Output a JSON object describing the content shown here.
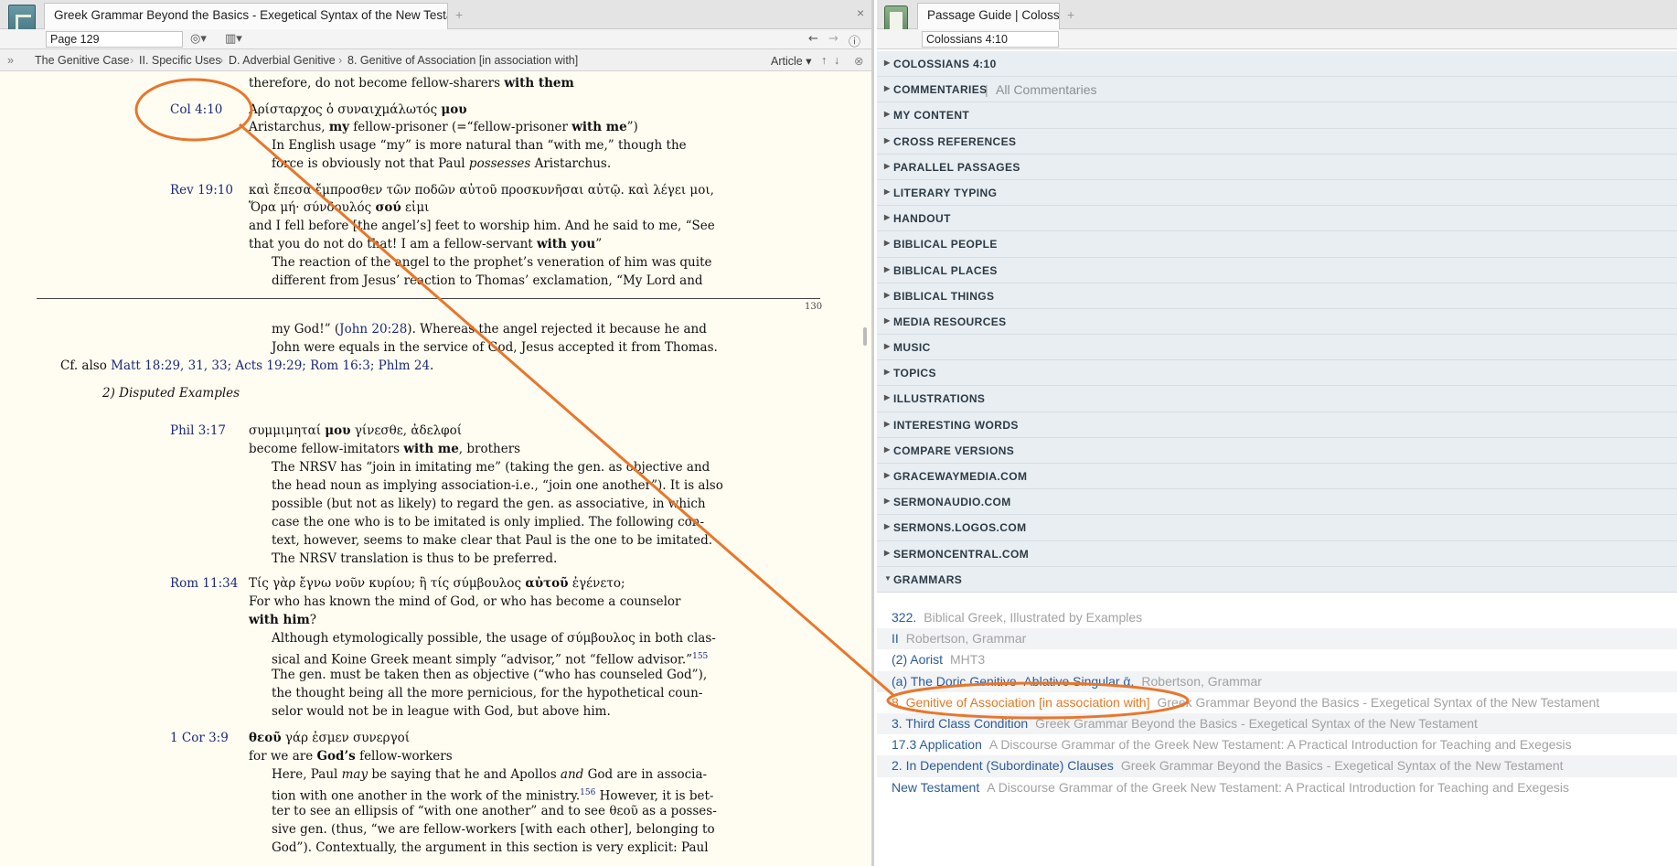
{
  "left": {
    "tab_title": "Greek Grammar Beyond the Basics - Exegetical Syntax of the New Testament",
    "add_tab": "+",
    "close_tab": "×",
    "page_input": "Page 129",
    "article_label": "Article",
    "breadcrumbs": [
      "The Genitive Case",
      "II. Specific Uses",
      "D. Adverbial Genitive",
      "8. Genitive of Association [in association with]"
    ],
    "page_number": "130"
  },
  "reader": {
    "l01": "therefore, do not become fellow-sharers ",
    "l01b": "with them",
    "ref_col": "Col 4:10",
    "g_col": "Ἀρίσταρχος ὁ συναιχμάλωτός ",
    "g_col_b": "μου",
    "t_col_1": "Aristarchus, ",
    "t_col_1b": "my",
    "t_col_1c": " fellow-prisoner (=“fellow-prisoner ",
    "t_col_1d": "with me",
    "t_col_1e": "”)",
    "n_col_1": "In English usage “my” is more natural than “with me,” though the",
    "n_col_2a": "force is obviously not that Paul ",
    "n_col_2b": "possesses",
    "n_col_2c": " Aristarchus.",
    "ref_rev": "Rev 19:10",
    "g_rev_1": "καὶ ἔπεσα ἔμπροσθεν τῶν ποδῶν αὐτοῦ προσκυνῆσαι αὐτῷ. καὶ λέγει μοι,",
    "g_rev_2a": " Ὅρα μή· σύνδουλός ",
    "g_rev_2b": "σού",
    "g_rev_2c": " εἰμι",
    "t_rev_1": "and I fell before [the angel’s] feet to worship him. And he said to me, “See",
    "t_rev_2a": "that you do not do that! I am a fellow-servant ",
    "t_rev_2b": "with you",
    "t_rev_2c": "”",
    "n_rev_1": "The reaction of the angel to the prophet’s veneration of him was quite",
    "n_rev_2": "different from Jesus’ reaction to Thomas’ exclamation, “My Lord and",
    "n_rev_3a": "my God!” (",
    "n_rev_3b": "John 20:28",
    "n_rev_3c": "). Whereas the angel rejected it because he and",
    "n_rev_4": "John were equals in the service of God, Jesus accepted it from Thomas.",
    "cf_a": "Cf. also ",
    "cf_links": "Matt 18:29, 31, 33; Acts 19:29; Rom 16:3; Phlm 24",
    "cf_end": ".",
    "disputed": "2) Disputed Examples",
    "ref_phil": "Phil 3:17",
    "g_phil_a": "συμμιμηταί ",
    "g_phil_b": "μου",
    "g_phil_c": " γίνεσθε, ἀδελφοί",
    "t_phil_a": "become fellow-imitators ",
    "t_phil_b": "with me",
    "t_phil_c": ", brothers",
    "n_phil_1": "The NRSV has “join in imitating me” (taking the gen. as objective and",
    "n_phil_2": "the head noun as implying association-i.e., “join one another”). It is also",
    "n_phil_3": "possible (but not as likely) to regard the gen. as associative, in which",
    "n_phil_4": "case the one who is to be imitated is only implied. The following con-",
    "n_phil_5": "text, however, seems to make clear that Paul is the one to be imitated.",
    "n_phil_6": "The NRSV translation is thus to be preferred.",
    "ref_rom": "Rom 11:34",
    "g_rom_a": "Τίς γὰρ ἔγνω νοῦν κυρίου; ἢ τίς σύμβουλος ",
    "g_rom_b": "αὐτοῦ",
    "g_rom_c": " ἐγένετο;",
    "t_rom_1": "For who has known the mind of God, or who has become a counselor",
    "t_rom_2": "with him",
    "t_rom_2b": "?",
    "n_rom_1": "Although etymologically possible, the usage of σύμβουλος in both clas-",
    "n_rom_2": "sical and Koine Greek meant simply “advisor,” not “fellow advisor.”",
    "n_rom_2fn": "155",
    "n_rom_3": "The gen. must be taken then as objective (“who has counseled God”),",
    "n_rom_4": "the thought being all the more pernicious, for the hypothetical coun-",
    "n_rom_5": "selor would not be in league with God, but above him.",
    "ref_cor": "1 Cor 3:9",
    "g_cor_a": "θεοῦ",
    "g_cor_b": " γάρ ἐσμεν συνεργοί",
    "t_cor_a": "for we are ",
    "t_cor_b": "God’s",
    "t_cor_c": " fellow-workers",
    "n_cor_1a": "Here, Paul ",
    "n_cor_1b": "may",
    "n_cor_1c": " be saying that he and Apollos ",
    "n_cor_1d": "and",
    "n_cor_1e": " God are in associa-",
    "n_cor_2": "tion with one another in the work of the ministry.",
    "n_cor_2fn": "156",
    "n_cor_2b": " However, it is bet-",
    "n_cor_3": "ter to see an ellipsis of “with one another” and to see θεοῦ as a posses-",
    "n_cor_4": "sive gen. (thus, “we are fellow-workers [with each other], belonging to",
    "n_cor_5": "God”). Contextually, the argument in this section is very explicit: Paul"
  },
  "right": {
    "tab_title": "Passage Guide | Colossians 4:10",
    "add_tab": "+",
    "passage_input": "Colossians 4:10",
    "sections": [
      {
        "label": "COLOSSIANS 4:10",
        "expanded": false
      },
      {
        "label": "COMMENTARIES",
        "sub": "All Commentaries",
        "expanded": false
      },
      {
        "label": "MY CONTENT",
        "expanded": false
      },
      {
        "label": "CROSS REFERENCES",
        "expanded": false
      },
      {
        "label": "PARALLEL PASSAGES",
        "expanded": false
      },
      {
        "label": "LITERARY TYPING",
        "expanded": false
      },
      {
        "label": "HANDOUT",
        "expanded": false
      },
      {
        "label": "BIBLICAL PEOPLE",
        "expanded": false
      },
      {
        "label": "BIBLICAL PLACES",
        "expanded": false
      },
      {
        "label": "BIBLICAL THINGS",
        "expanded": false
      },
      {
        "label": "MEDIA RESOURCES",
        "expanded": false
      },
      {
        "label": "MUSIC",
        "expanded": false
      },
      {
        "label": "TOPICS",
        "expanded": false
      },
      {
        "label": "ILLUSTRATIONS",
        "expanded": false
      },
      {
        "label": "INTERESTING WORDS",
        "expanded": false
      },
      {
        "label": "COMPARE VERSIONS",
        "expanded": false
      },
      {
        "label": "GRACEWAYMEDIA.COM",
        "expanded": false
      },
      {
        "label": "SERMONAUDIO.COM",
        "expanded": false
      },
      {
        "label": "SERMONS.LOGOS.COM",
        "expanded": false
      },
      {
        "label": "SERMONCENTRAL.COM",
        "expanded": false
      },
      {
        "label": "GRAMMARS",
        "expanded": true
      }
    ],
    "grammars": [
      {
        "title": "322.",
        "source": "Biblical Greek, Illustrated by Examples",
        "active": false
      },
      {
        "title": "II",
        "source": "Robertson, Grammar",
        "active": false
      },
      {
        "title": "(2) Aorist",
        "source": "MHT3",
        "active": false
      },
      {
        "title": "(a) The Doric Genitive–Ablative Singular ᾱ.",
        "source": "Robertson, Grammar",
        "active": false
      },
      {
        "title": "8. Genitive of Association [in association with]",
        "source": "Greek Grammar Beyond the Basics - Exegetical Syntax of the New Testament",
        "active": true
      },
      {
        "title": "3. Third Class Condition",
        "source": "Greek Grammar Beyond the Basics - Exegetical Syntax of the New Testament",
        "active": false
      },
      {
        "title": "17.3 Application",
        "source": "A Discourse Grammar of the Greek New Testament: A Practical Introduction for Teaching and Exegesis",
        "active": false
      },
      {
        "title": "2. In Dependent (Subordinate) Clauses",
        "source": "Greek Grammar Beyond the Basics - Exegetical Syntax of the New Testament",
        "active": false
      },
      {
        "title": "New Testament",
        "source": "A Discourse Grammar of the Greek New Testament: A Practical Introduction for Teaching and Exegesis",
        "active": false
      }
    ]
  },
  "colors": {
    "annotation": "#e8762a",
    "link": "#2b5b9b",
    "reference": "#1b2a7a",
    "reader_bg": "#fffdf2",
    "section_bg": "#e8eef2"
  }
}
